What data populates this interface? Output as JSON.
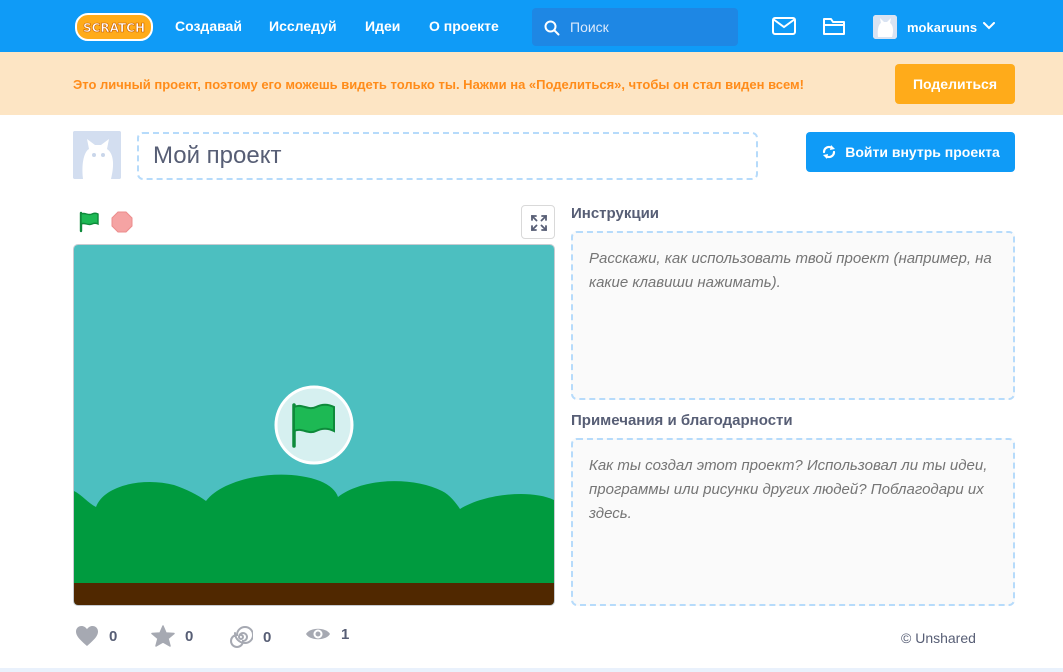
{
  "nav": {
    "logo_text": "SCRATCH",
    "links": [
      "Создавай",
      "Исследуй",
      "Идеи",
      "О проекте"
    ],
    "search_placeholder": "Поиск",
    "username": "mokaruuns"
  },
  "banner": {
    "message": "Это личный проект, поэтому его можешь видеть только ты. Нажми на «Поделиться», чтобы он стал виден всем!",
    "share_label": "Поделиться"
  },
  "project": {
    "title": "Мой проект",
    "see_inside_label": "Войти внутрь проекта"
  },
  "instructions": {
    "label": "Инструкции",
    "placeholder": "Расскажи, как использовать твой проект (например, на какие клавиши нажимать)."
  },
  "notes": {
    "label": "Примечания и благодарности",
    "placeholder": "Как ты создал этот проект? Использовал ли ты идеи, программы или рисунки других людей? Поблагодари их здесь."
  },
  "stats": {
    "loves": "0",
    "favorites": "0",
    "remixes": "0",
    "views": "1"
  },
  "sharing_status": "© Unshared",
  "colors": {
    "nav_blue": "#0f9bf7",
    "banner_bg": "#fde5c4",
    "banner_text": "#ff8c1a",
    "share_orange": "#ffab1a",
    "stage_sky": "#4cbfc0",
    "stage_bush": "#009b3f",
    "stage_ground": "#502800"
  }
}
